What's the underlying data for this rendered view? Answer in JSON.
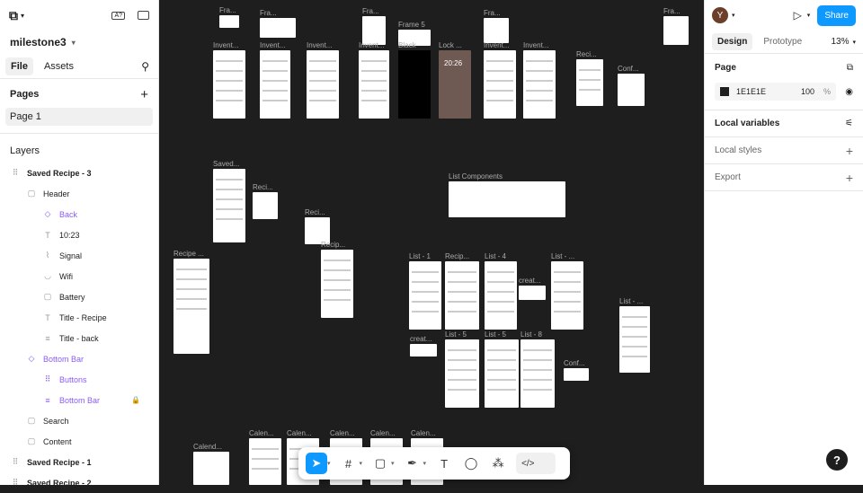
{
  "left": {
    "project_name": "milestone3",
    "tabs": [
      "File",
      "Assets"
    ],
    "pages_title": "Pages",
    "pages": [
      "Page 1"
    ],
    "layers_title": "Layers",
    "layers": [
      {
        "label": "Saved Recipe - 3",
        "indent": 0,
        "icon": "grid-icon",
        "glyph": "⠿",
        "bold": true,
        "color": ""
      },
      {
        "label": "Header",
        "indent": 1,
        "icon": "frame-icon",
        "glyph": "▢",
        "bold": false,
        "color": ""
      },
      {
        "label": "Back",
        "indent": 2,
        "icon": "component-icon",
        "glyph": "◇",
        "bold": false,
        "color": "#8b5cf6"
      },
      {
        "label": "10:23",
        "indent": 2,
        "icon": "text-icon",
        "glyph": "T",
        "bold": false,
        "color": ""
      },
      {
        "label": "Signal",
        "indent": 2,
        "icon": "vector-icon",
        "glyph": "⌇",
        "bold": false,
        "color": ""
      },
      {
        "label": "Wifi",
        "indent": 2,
        "icon": "wifi-icon",
        "glyph": "◡",
        "bold": false,
        "color": ""
      },
      {
        "label": "Battery",
        "indent": 2,
        "icon": "frame-icon",
        "glyph": "▢",
        "bold": false,
        "color": ""
      },
      {
        "label": "Title - Recipe",
        "indent": 2,
        "icon": "text-icon",
        "glyph": "T",
        "bold": false,
        "color": ""
      },
      {
        "label": "Title - back",
        "indent": 2,
        "icon": "line-icon",
        "glyph": "≡",
        "bold": false,
        "color": ""
      },
      {
        "label": "Bottom Bar",
        "indent": 1,
        "icon": "component-icon",
        "glyph": "◇",
        "bold": false,
        "color": "#8b5cf6"
      },
      {
        "label": "Buttons",
        "indent": 2,
        "icon": "instance-icon",
        "glyph": "⠿",
        "bold": false,
        "color": "#8b5cf6"
      },
      {
        "label": "Bottom Bar",
        "indent": 2,
        "icon": "line-icon",
        "glyph": "≡",
        "bold": false,
        "color": "#8b5cf6"
      },
      {
        "label": "Search",
        "indent": 1,
        "icon": "frame-icon",
        "glyph": "▢",
        "bold": false,
        "color": ""
      },
      {
        "label": "Content",
        "indent": 1,
        "icon": "frame-icon",
        "glyph": "▢",
        "bold": false,
        "color": ""
      },
      {
        "label": "Saved Recipe - 1",
        "indent": 0,
        "icon": "grid-icon",
        "glyph": "⠿",
        "bold": true,
        "color": ""
      },
      {
        "label": "Saved Recipe - 2",
        "indent": 0,
        "icon": "grid-icon",
        "glyph": "⠿",
        "bold": true,
        "color": ""
      }
    ]
  },
  "right": {
    "avatar_letter": "Y",
    "share_label": "Share",
    "tabs": [
      "Design",
      "Prototype"
    ],
    "zoom": "13%",
    "page_section": "Page",
    "page_color_hex": "1E1E1E",
    "page_color": "#1e1e1e",
    "opacity": "100",
    "opacity_unit": "%",
    "local_variables": "Local variables",
    "local_styles": "Local styles",
    "export": "Export"
  },
  "canvas": {
    "frame_labels": [
      "Fra...",
      "Fra...",
      "Fra...",
      "Frame 5",
      "Fra...",
      "Fra...",
      "Invent...",
      "Invent...",
      "Invent...",
      "Invent...",
      "Black",
      "Lock ...",
      "Invent...",
      "Invent...",
      "Reci...",
      "Conf...",
      "Saved...",
      "Reci...",
      "List Components",
      "Recipe ...",
      "Reci...",
      "Recip...",
      "List - 1",
      "Recip...",
      "List - 4",
      "List - ...",
      "creat...",
      "List - ...",
      "creat...",
      "List - 5",
      "List - 5",
      "List - 8",
      "Conf...",
      "Calend...",
      "Calen...",
      "Calen...",
      "Calen...",
      "Calen...",
      "Calen..."
    ],
    "lock_time": "20:26"
  },
  "toolbar": {
    "tools": [
      "move-tool",
      "frame-tool",
      "shape-tool",
      "pen-tool",
      "text-tool",
      "comment-tool",
      "actions-tool",
      "dev-mode-toggle"
    ]
  },
  "help_label": "?"
}
